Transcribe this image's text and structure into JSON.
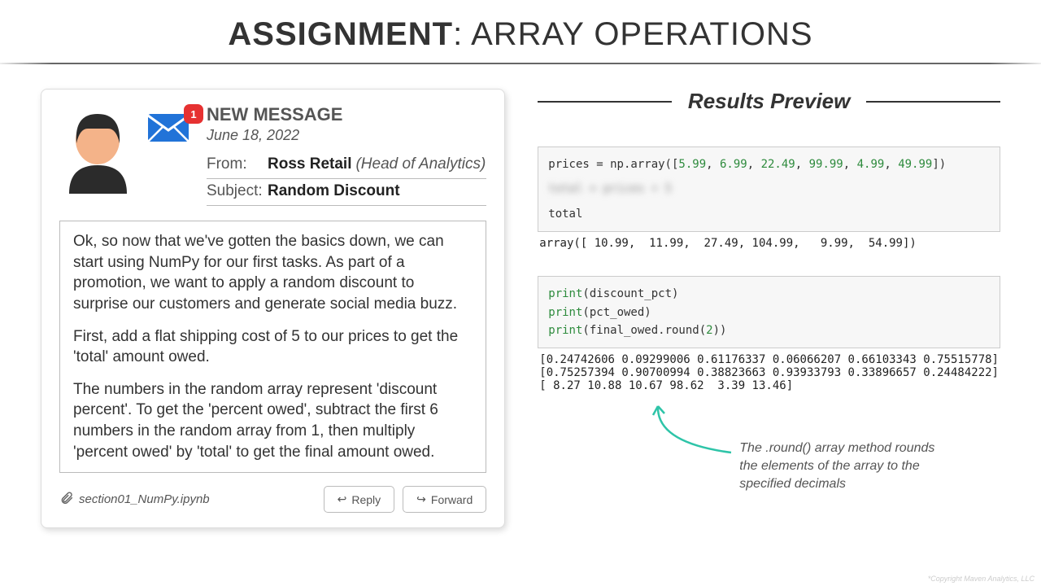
{
  "header": {
    "bold": "ASSIGNMENT",
    "rest": ": ARRAY OPERATIONS"
  },
  "message": {
    "badge": "1",
    "new_label": "NEW MESSAGE",
    "date": "June 18, 2022",
    "from_label": "From:",
    "from_name": "Ross Retail",
    "from_title": "(Head of Analytics)",
    "subject_label": "Subject:",
    "subject": "Random Discount",
    "body": {
      "p1": "Ok, so now that we've gotten the basics down, we can start using NumPy for our first tasks. As part of a promotion, we want to apply a random discount to surprise our customers and generate social media buzz.",
      "p2": "First, add a flat shipping cost of 5 to our prices to get the 'total' amount owed.",
      "p3": "The numbers in the random array represent 'discount percent'. To get the 'percent owed', subtract the first 6 numbers in the random array from 1, then multiply 'percent owed' by 'total' to get the final amount owed."
    },
    "attachment": "section01_NumPy.ipynb",
    "reply": "Reply",
    "forward": "Forward"
  },
  "preview": {
    "title": "Results Preview",
    "cell1": {
      "line1_pre": "prices = np.array([",
      "values": [
        "5.99",
        "6.99",
        "22.49",
        "99.99",
        "4.99",
        "49.99"
      ],
      "line1_post": "])",
      "blurred": "total = prices + 5",
      "line3": "total"
    },
    "out1": "array([ 10.99,  11.99,  27.49, 104.99,   9.99,  54.99])",
    "cell2": {
      "l1": "print(discount_pct)",
      "l2": "print(pct_owed)",
      "l3": "print(final_owed.round(2))"
    },
    "out2": "[0.24742606 0.09299006 0.61176337 0.06066207 0.66103343 0.75515778]\n[0.75257394 0.90700994 0.38823663 0.93933793 0.33896657 0.24484222]\n[ 8.27 10.88 10.67 98.62  3.39 13.46]",
    "annotation": "The .round() array method rounds the elements of the array to the specified decimals"
  },
  "copyright": "*Copyright Maven Analytics, LLC",
  "chart_data": {
    "type": "table",
    "prices": [
      5.99,
      6.99,
      22.49,
      99.99,
      4.99,
      49.99
    ],
    "total": [
      10.99,
      11.99,
      27.49,
      104.99,
      9.99,
      54.99
    ],
    "discount_pct": [
      0.24742606,
      0.09299006,
      0.61176337,
      0.06066207,
      0.66103343,
      0.75515778
    ],
    "pct_owed": [
      0.75257394,
      0.90700994,
      0.38823663,
      0.93933793,
      0.33896657,
      0.24484222
    ],
    "final_owed_rounded": [
      8.27,
      10.88,
      10.67,
      98.62,
      3.39,
      13.46
    ]
  }
}
